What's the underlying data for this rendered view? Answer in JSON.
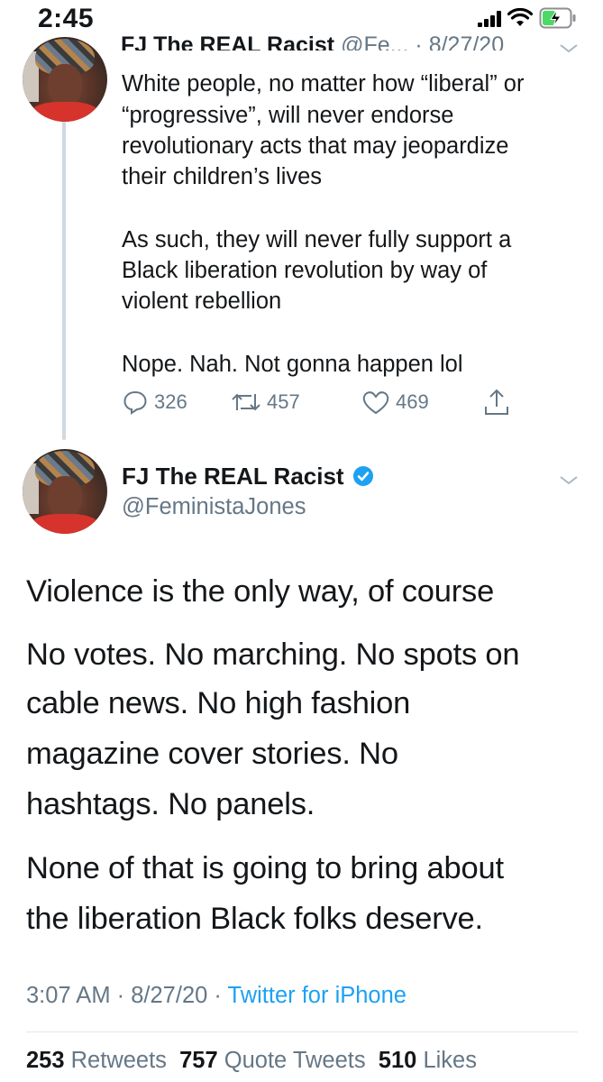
{
  "status_bar": {
    "time": "2:45"
  },
  "thread": {
    "previous_tweet": {
      "header_name": "FJ The REAL Racist",
      "header_handle": "@Fe...",
      "header_date": "8/27/20",
      "paragraphs": [
        [
          "White people, no matter how “liberal” or",
          "“progressive”, will never endorse",
          "revolutionary acts that may jeopardize",
          "their children’s lives"
        ],
        [
          "As such, they will never fully support a",
          "Black liberation revolution by way of",
          "violent rebellion"
        ],
        [
          "Nope. Nah. Not gonna happen lol"
        ]
      ],
      "actions": {
        "replies": "326",
        "retweets": "457",
        "likes": "469"
      }
    },
    "main_tweet": {
      "name": "FJ The REAL Racist",
      "handle": "@FeministaJones",
      "lines": [
        "Violence is the only way, of course",
        "No votes. No marching. No spots on",
        "cable news. No high fashion",
        "magazine cover stories. No",
        "hashtags. No panels.",
        "None of that is going to bring about",
        "the liberation Black folks deserve."
      ],
      "time": "3:07 AM",
      "date": "8/27/20",
      "source": "Twitter for iPhone",
      "stats": {
        "retweets": "253",
        "retweets_label": "Retweets",
        "quote_tweets": "757",
        "quote_tweets_label": "Quote Tweets",
        "likes": "510",
        "likes_label": "Likes"
      }
    }
  },
  "colors": {
    "accent": "#1da1f2",
    "secondary_text": "#657786",
    "verified": "#1da1f2"
  }
}
